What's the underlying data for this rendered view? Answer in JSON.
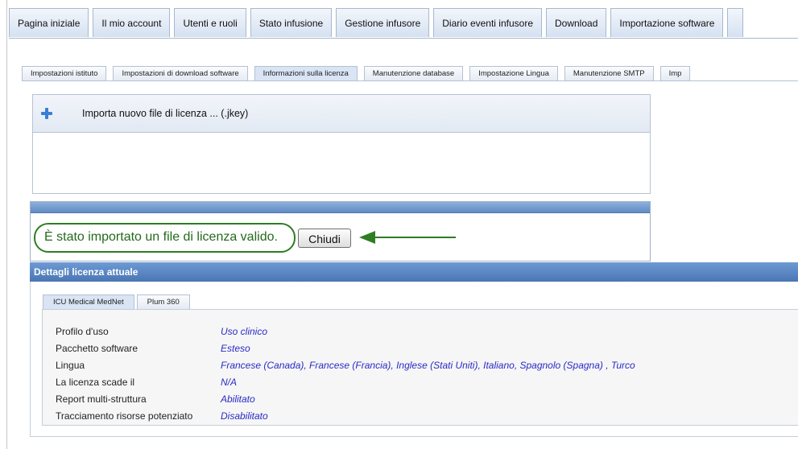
{
  "main_tabs": [
    "Pagina iniziale",
    "Il mio account",
    "Utenti e ruoli",
    "Stato infusione",
    "Gestione infusore",
    "Diario eventi infusore",
    "Download",
    "Importazione software"
  ],
  "sub_tabs": [
    {
      "label": "Impostazioni istituto",
      "active": false
    },
    {
      "label": "Impostazioni di download software",
      "active": false
    },
    {
      "label": "Informazioni sulla licenza",
      "active": true
    },
    {
      "label": "Manutenzione database",
      "active": false
    },
    {
      "label": "Impostazione Lingua",
      "active": false
    },
    {
      "label": "Manutenzione SMTP",
      "active": false
    },
    {
      "label": "Imp",
      "active": false
    }
  ],
  "import_panel": {
    "label": "Importa nuovo file di licenza ... (.jkey)"
  },
  "message": {
    "text": "È stato importato un file di licenza valido.",
    "close_label": "Chiudi"
  },
  "details": {
    "header": "Dettagli licenza attuale",
    "tabs": [
      {
        "label": "ICU Medical MedNet",
        "active": true
      },
      {
        "label": "Plum 360",
        "active": false
      }
    ],
    "rows": [
      {
        "label": "Profilo d'uso",
        "value": "Uso clinico"
      },
      {
        "label": "Pacchetto software",
        "value": "Esteso"
      },
      {
        "label": "Lingua",
        "value": "Francese (Canada), Francese (Francia), Inglese (Stati Uniti), Italiano, Spagnolo (Spagna) , Turco"
      },
      {
        "label": "La licenza scade il",
        "value": "N/A"
      },
      {
        "label": "Report multi-struttura",
        "value": "Abilitato"
      },
      {
        "label": "Tracciamento risorse potenziato",
        "value": "Disabilitato"
      }
    ]
  },
  "colors": {
    "accent": "#4a76b4",
    "annotation": "#2e7d22",
    "value_text": "#2a2ac8"
  }
}
